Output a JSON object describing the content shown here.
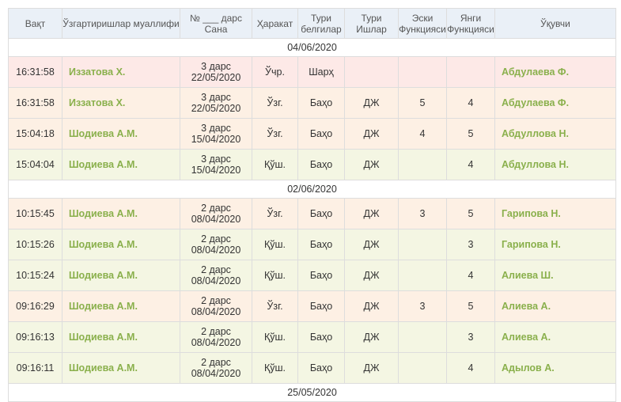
{
  "columns": [
    "Вақт",
    "Ўзгартиришлар муаллифи",
    "№ ___ дарс\nСана",
    "Ҳаракат",
    "Тури\nбелгилар",
    "Тури\nИшлар",
    "Эски\nФункцияси",
    "Янги\nФункцияси",
    "Ўқувчи"
  ],
  "groups": [
    {
      "date": "04/06/2020",
      "rows": [
        {
          "tint": "red",
          "time": "16:31:58",
          "author": "Иззатова Х.",
          "lesson": "3 дарс",
          "date": "22/05/2020",
          "action": "Ўчр.",
          "mark_type": "Шарҳ",
          "work_type": "",
          "old": "",
          "new": "",
          "student": "Абдулаева Ф."
        },
        {
          "tint": "orange",
          "time": "16:31:58",
          "author": "Иззатова Х.",
          "lesson": "3 дарс",
          "date": "22/05/2020",
          "action": "Ўзг.",
          "mark_type": "Баҳо",
          "work_type": "ДЖ",
          "old": "5",
          "new": "4",
          "student": "Абдулаева Ф."
        },
        {
          "tint": "orange",
          "time": "15:04:18",
          "author": "Шодиева А.М.",
          "lesson": "3 дарс",
          "date": "15/04/2020",
          "action": "Ўзг.",
          "mark_type": "Баҳо",
          "work_type": "ДЖ",
          "old": "4",
          "new": "5",
          "student": "Абдуллова Н."
        },
        {
          "tint": "green",
          "time": "15:04:04",
          "author": "Шодиева А.М.",
          "lesson": "3 дарс",
          "date": "15/04/2020",
          "action": "Қўш.",
          "mark_type": "Баҳо",
          "work_type": "ДЖ",
          "old": "",
          "new": "4",
          "student": "Абдуллова Н."
        }
      ]
    },
    {
      "date": "02/06/2020",
      "rows": [
        {
          "tint": "orange",
          "time": "10:15:45",
          "author": "Шодиева А.М.",
          "lesson": "2 дарс",
          "date": "08/04/2020",
          "action": "Ўзг.",
          "mark_type": "Баҳо",
          "work_type": "ДЖ",
          "old": "3",
          "new": "5",
          "student": "Гарипова Н."
        },
        {
          "tint": "green",
          "time": "10:15:26",
          "author": "Шодиева А.М.",
          "lesson": "2 дарс",
          "date": "08/04/2020",
          "action": "Қўш.",
          "mark_type": "Баҳо",
          "work_type": "ДЖ",
          "old": "",
          "new": "3",
          "student": "Гарипова Н."
        },
        {
          "tint": "green",
          "time": "10:15:24",
          "author": "Шодиева А.М.",
          "lesson": "2 дарс",
          "date": "08/04/2020",
          "action": "Қўш.",
          "mark_type": "Баҳо",
          "work_type": "ДЖ",
          "old": "",
          "new": "4",
          "student": "Алиева Ш."
        },
        {
          "tint": "orange",
          "time": "09:16:29",
          "author": "Шодиева А.М.",
          "lesson": "2 дарс",
          "date": "08/04/2020",
          "action": "Ўзг.",
          "mark_type": "Баҳо",
          "work_type": "ДЖ",
          "old": "3",
          "new": "5",
          "student": "Алиева А."
        },
        {
          "tint": "green",
          "time": "09:16:13",
          "author": "Шодиева А.М.",
          "lesson": "2 дарс",
          "date": "08/04/2020",
          "action": "Қўш.",
          "mark_type": "Баҳо",
          "work_type": "ДЖ",
          "old": "",
          "new": "3",
          "student": "Алиева А."
        },
        {
          "tint": "green",
          "time": "09:16:11",
          "author": "Шодиева А.М.",
          "lesson": "2 дарс",
          "date": "08/04/2020",
          "action": "Қўш.",
          "mark_type": "Баҳо",
          "work_type": "ДЖ",
          "old": "",
          "new": "4",
          "student": "Адылов А."
        }
      ]
    },
    {
      "date": "25/05/2020",
      "rows": []
    }
  ],
  "colors": {
    "header_bg": "#eaf0f7",
    "row_changed": "#fdf0e4",
    "row_added": "#f4f6e3",
    "row_deleted": "#fde9e7",
    "name_link": "#8ab04c"
  }
}
